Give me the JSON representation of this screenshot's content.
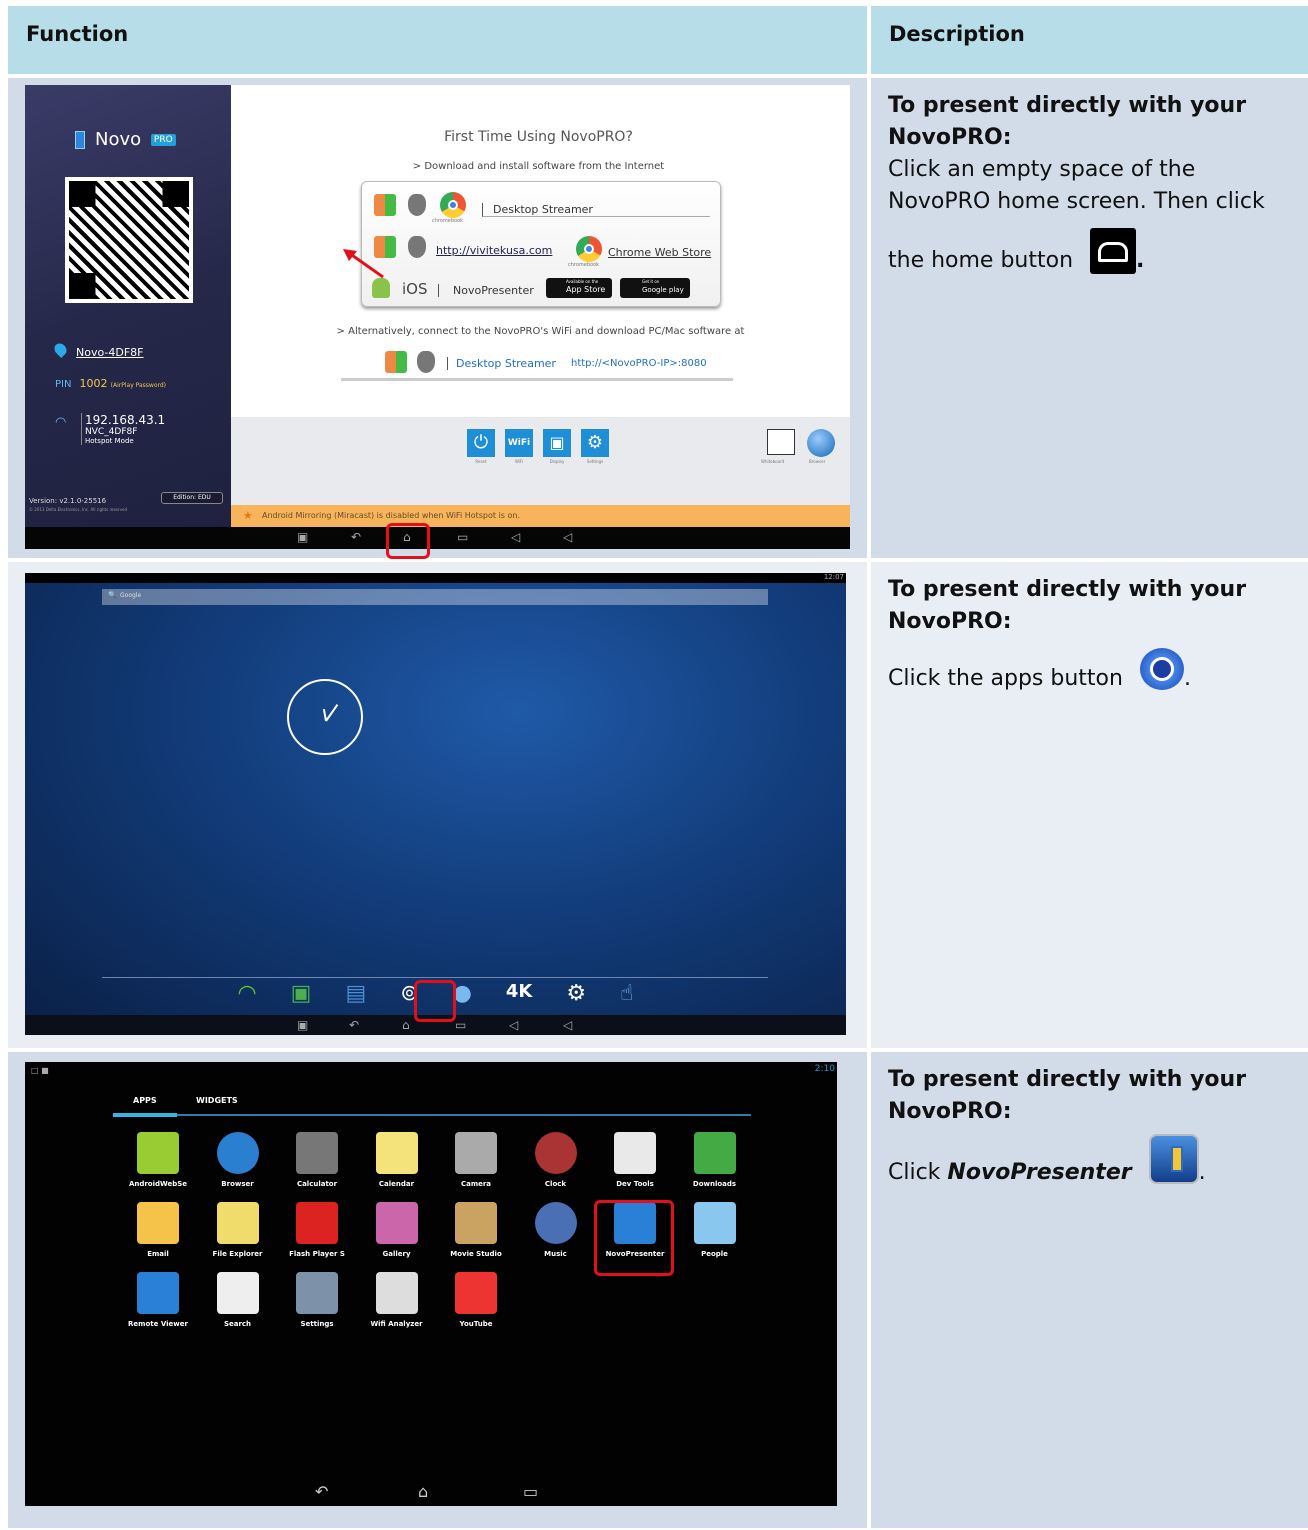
{
  "header": {
    "function": "Function",
    "description": "Description"
  },
  "rows": [
    {
      "title": "To present directly with your NovoPRO:",
      "line1": "Click an empty space of the",
      "line2": "NovoPRO home screen. Then click",
      "line3": "the home button",
      "end": "."
    },
    {
      "title": "To present directly with your NovoPRO:",
      "line1": "Click the apps button",
      "end": "."
    },
    {
      "title": "To present directly with your NovoPRO:",
      "line1": "Click",
      "italic": "NovoPresenter",
      "end": "."
    }
  ],
  "shot1": {
    "brand": "Novo",
    "brand_badge": "PRO",
    "device": "Novo-4DF8F",
    "pin_label": "PIN",
    "pin": "1002",
    "pin_note": "(AirPlay Password)",
    "ip": "192.168.43.1",
    "ssid": "NVC_4DF8F",
    "mode": "Hotspot Mode",
    "version": "Version: v2.1.0-25516",
    "copyright": "© 2013 Delta Electronics, Inc. All rights reserved",
    "edition": "Edition: EDU",
    "title": "First Time Using NovoPRO?",
    "sub1": "> Download and install software from the Internet",
    "desktop_streamer": "Desktop Streamer",
    "chromebook": "chromebook",
    "url": "http://vivitekusa.com",
    "chrome_store": "Chrome Web Store",
    "ios": "iOS",
    "novopresenter": "NovoPresenter",
    "appstore_small": "Available on the",
    "appstore": "App Store",
    "gplay_small": "Get it on",
    "gplay": "Google play",
    "sub2": "> Alternatively, connect to the NovoPRO's WiFi and download PC/Mac software at",
    "ds2": "Desktop Streamer",
    "ip_url": "http://<NovoPRO-IP>:8080",
    "tiles": [
      "Reset",
      "WiFi",
      "Display",
      "Settings"
    ],
    "tiles_right": [
      "Whiteboard",
      "Browser"
    ],
    "notice": "Android Mirroring (Miracast) is disabled when WiFi Hotspot is on."
  },
  "shot2": {
    "time": "12:07",
    "search": "Google"
  },
  "shot3": {
    "tabs": [
      "APPS",
      "WIDGETS"
    ],
    "status_time": "2:10",
    "apps": [
      "AndroidWebSe",
      "Browser",
      "Calculator",
      "Calendar",
      "Camera",
      "Clock",
      "Dev Tools",
      "Downloads",
      "Email",
      "File Explorer",
      "Flash Player S",
      "Gallery",
      "Movie Studio",
      "Music",
      "NovoPresenter",
      "People",
      "Remote Viewer",
      "Search",
      "Settings",
      "Wifi Analyzer",
      "YouTube"
    ]
  }
}
